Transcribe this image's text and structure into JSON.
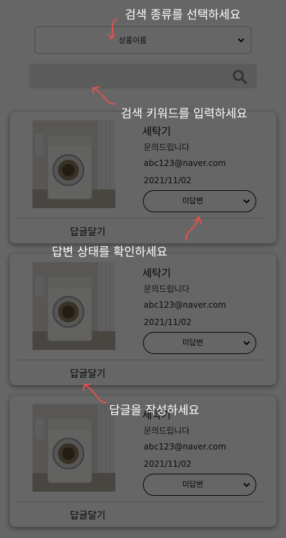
{
  "search": {
    "type_value": "상품이름",
    "keyword_placeholder": ""
  },
  "items": [
    {
      "title": "세탁기",
      "subject": "문의드립니다",
      "email": "abc123@naver.com",
      "date": "2021/11/02",
      "status": "미답변",
      "reply_label": "답글달기"
    },
    {
      "title": "세탁기",
      "subject": "문의드립니다",
      "email": "abc123@naver.com",
      "date": "2021/11/02",
      "status": "미답변",
      "reply_label": "답글달기"
    },
    {
      "title": "세탁기",
      "subject": "문의드립니다",
      "email": "abc123@naver.com",
      "date": "2021/11/02",
      "status": "미답변",
      "reply_label": "답글달기"
    }
  ],
  "guide": {
    "select_search_type": "검색 종류를 선택하세요",
    "enter_keyword": "검색 키워드를 입력하세요",
    "check_status": "답변 상태를 확인하세요",
    "write_reply": "답글을 작성하세요"
  },
  "colors": {
    "overlay": "#000000",
    "arrow": "#e0524f"
  }
}
